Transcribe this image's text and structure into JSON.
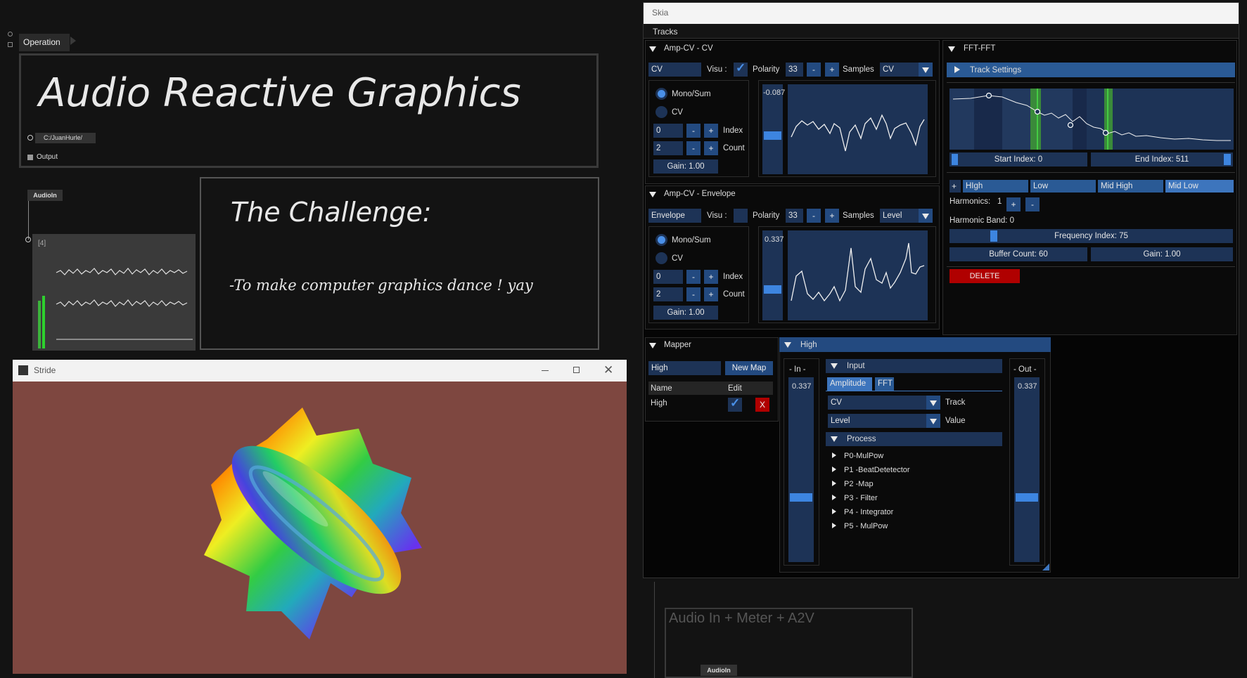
{
  "patch": {
    "operation_tab": "Operation",
    "main_title": "Audio Reactive Graphics",
    "path_value": "C:/JuanHurle/",
    "output_label": "Output",
    "audioin_node": "AudioIn",
    "scope_index": "[4]",
    "challenge_title": "The Challenge:",
    "challenge_text": "-To make computer graphics dance ! yay",
    "bottom_box_title": "Audio In + Meter + A2V",
    "bottom_audioin_node": "AudioIn"
  },
  "stride": {
    "title": "Stride",
    "minimize_icon": "minimize-icon",
    "maximize_icon": "maximize-icon",
    "close_icon": "close-icon",
    "background_color": "#7e4740"
  },
  "skia": {
    "title": "Skia",
    "tracks_label": "Tracks",
    "amp_cv": {
      "header": "Amp-CV - CV",
      "name": "CV",
      "visu_label": "Visu :",
      "visu_checked": true,
      "polarity_label": "Polarity",
      "polarity_value": "33",
      "minus": "-",
      "plus": "+",
      "samples_label": "Samples",
      "samples_value": "CV",
      "mono_label": "Mono/Sum",
      "cv_label": "CV",
      "index_value": "0",
      "index_label": "Index",
      "count_value": "2",
      "count_label": "Count",
      "gain": "Gain: 1.00",
      "meter_value": "-0.087"
    },
    "amp_env": {
      "header": "Amp-CV - Envelope",
      "name": "Envelope",
      "visu_label": "Visu :",
      "visu_checked": false,
      "polarity_label": "Polarity",
      "polarity_value": "33",
      "minus": "-",
      "plus": "+",
      "samples_label": "Samples",
      "samples_value": "Level",
      "mono_label": "Mono/Sum",
      "cv_label": "CV",
      "index_value": "0",
      "index_label": "Index",
      "count_value": "2",
      "count_label": "Count",
      "gain": "Gain: 1.00",
      "meter_value": "0.337"
    },
    "fft": {
      "header": "FFT-FFT",
      "track_settings": "Track Settings",
      "start_index": "Start Index: 0",
      "end_index": "End Index: 511",
      "add": "+",
      "bands": [
        "HIgh",
        "Low",
        "Mid High",
        "Mid Low"
      ],
      "harmonics_label": "Harmonics:",
      "harmonics_value": "1",
      "harmonics_plus": "+",
      "harmonics_minus": "-",
      "harmonic_band": "Harmonic Band: 0",
      "frequency_index": "Frequency Index: 75",
      "buffer_count": "Buffer Count: 60",
      "gain": "Gain: 1.00",
      "delete": "DELETE"
    },
    "mapper": {
      "header": "Mapper",
      "map_name": "High",
      "new_map": "New Map",
      "col_name": "Name",
      "col_edit": "Edit",
      "row_name": "High",
      "row_edit_checked": true,
      "row_delete": "X"
    },
    "high": {
      "header": "High",
      "in_label": "- In -",
      "in_value": "0.337",
      "out_label": "- Out -",
      "out_value": "0.337",
      "input_header": "Input",
      "tab_amplitude": "Amplitude",
      "tab_fft": "FFT",
      "track_select": "CV",
      "track_label": "Track",
      "value_select": "Level",
      "value_label": "Value",
      "process_header": "Process",
      "processes": [
        "P0-MulPow",
        "P1 -BeatDetetector",
        "P2 -Map",
        "P3 - Filter",
        "P4 - Integrator",
        "P5 - MulPow"
      ]
    }
  },
  "colors": {
    "accent": "#4a90e8",
    "field": "#1d3356",
    "delete": "#b00000"
  }
}
